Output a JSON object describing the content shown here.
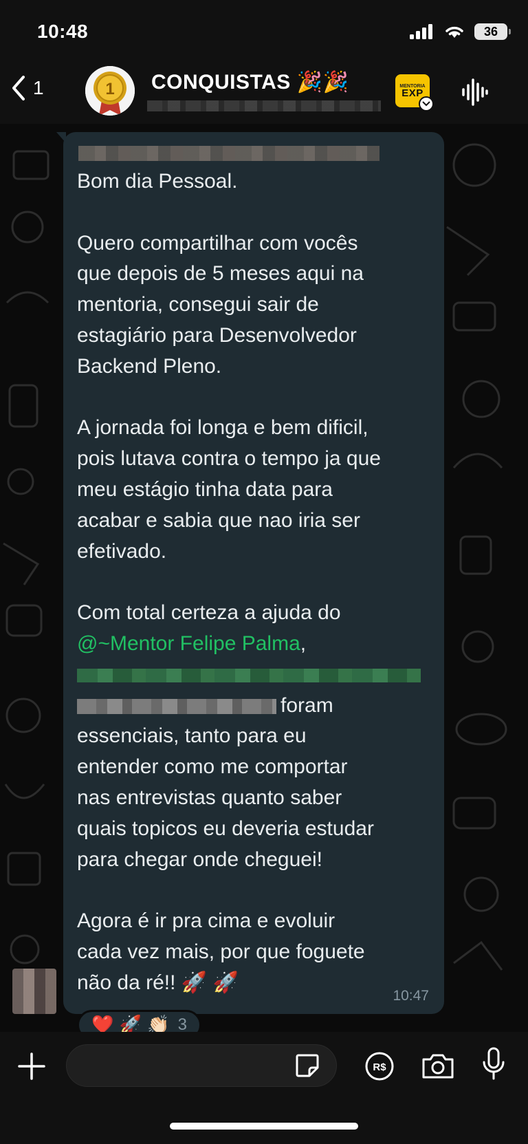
{
  "status_bar": {
    "time": "10:48",
    "battery": "36"
  },
  "header": {
    "back_count": "1",
    "group_name": "CONQUISTAS 🎉🎉",
    "exp_badge_small": "MENTORIA",
    "exp_badge_big": "EXP"
  },
  "message": {
    "lines": [
      "Bom dia Pessoal.",
      "",
      "Quero compartilhar com vocês",
      "que depois de 5 meses aqui na",
      "mentoria, consegui sair de",
      "estagiário para Desenvolvedor",
      "Backend Pleno.",
      "",
      "A jornada foi longa e bem dificil,",
      "pois lutava contra o tempo ja que",
      "meu estágio tinha data para",
      "acabar e sabia que nao iria ser",
      "efetivado.",
      "",
      "Com total certeza a ajuda do"
    ],
    "mention": "@~Mentor Felipe Palma",
    "mention_suffix": ",",
    "after_blur": "foram",
    "lines_after": [
      "essenciais, tanto para eu",
      "entender como me comportar",
      "nas entrevistas quanto saber",
      "quais topicos eu deveria estudar",
      "para chegar onde cheguei!",
      "",
      "Agora é ir pra cima e evoluir",
      "cada vez mais, por que foguete",
      "não da ré!! 🚀 🚀"
    ],
    "time": "10:47"
  },
  "reactions": {
    "emojis": "❤️ 🚀 👏🏻",
    "count": "3"
  },
  "composer": {
    "placeholder": ""
  },
  "colors": {
    "bubble": "#1f2c33",
    "mention": "#21c063",
    "background": "#0b0b0b",
    "accent_badge": "#f6c400"
  },
  "icons": [
    "chevron-left-icon",
    "group-avatar",
    "exp-badge-icon",
    "audio-wave-icon",
    "plus-icon",
    "sticker-icon",
    "pay-icon",
    "camera-icon",
    "mic-icon"
  ]
}
